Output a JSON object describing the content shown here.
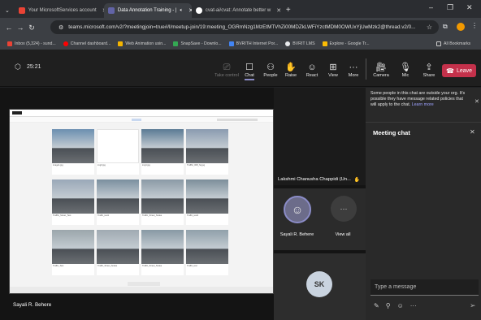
{
  "browser": {
    "tabs": [
      {
        "label": "Your MicrosoftServices account",
        "icon_color": "#ea4335",
        "active": false
      },
      {
        "label": "Data Annotation Training - |",
        "icon_color": "#6264a7",
        "active": true
      },
      {
        "label": "cvat-ai/cvat: Annotate better w",
        "icon_color": "#ffffff",
        "active": false
      }
    ],
    "new_tab": "+",
    "window_controls": [
      "–",
      "❐",
      "✕"
    ],
    "url": "teams.microsoft.com/v2/?meetingjoin=true#/l/meetup-join/19:meeting_OGRmNzg1MzEtMTVhZi00MDZkLWFiYzctMDM0OWUxYjUwMzk2@thread.v2/0..."
  },
  "bookmarks": [
    {
      "label": "Inbox (5,324) - sund...",
      "color": "#ea4335"
    },
    {
      "label": "Channel dashboard...",
      "color": "#ff0000"
    },
    {
      "label": "Web Animation usin...",
      "color": "#f4b400"
    },
    {
      "label": "SnapSave - Downlo...",
      "color": "#34a853"
    },
    {
      "label": "BVRITH Internet Por...",
      "color": "#4285f4"
    },
    {
      "label": "BVRIT LMS",
      "color": "#e8eaed"
    },
    {
      "label": "Explore - Google Tr...",
      "color": "#fbbc04"
    }
  ],
  "all_bookmarks": "All Bookmarks",
  "meeting": {
    "timer": "25:21",
    "toolbar": [
      {
        "label": "Take control",
        "glyph": "⎚",
        "dim": true
      },
      {
        "label": "Chat",
        "glyph": "☐",
        "dim": false
      },
      {
        "label": "People",
        "glyph": "⚇",
        "dim": false
      },
      {
        "label": "Raise",
        "glyph": "✋",
        "dim": false
      },
      {
        "label": "React",
        "glyph": "☺",
        "dim": false
      },
      {
        "label": "View",
        "glyph": "⊞",
        "dim": false
      },
      {
        "label": "More",
        "glyph": "···",
        "dim": false
      }
    ],
    "media": [
      {
        "label": "Camera",
        "glyph": "🎥︎"
      },
      {
        "label": "Mic",
        "glyph": "🎙︎"
      },
      {
        "label": "Share",
        "glyph": "⇪"
      }
    ],
    "leave_label": "Leave",
    "presenter_name": "Sayali R. Behere",
    "participants": [
      {
        "name": "Lakshmi Chanusha Chappidi (Un...",
        "status": "✋"
      },
      {
        "name": "Sayali R. Behere"
      },
      {
        "name": "View all",
        "glyph": "···"
      }
    ],
    "self_initials": "SK"
  },
  "chat": {
    "notice": "Some people in this chat are outside your org. It's possible they have message related policies that will apply to the chat.",
    "learn_more": "Learn more",
    "title": "Meeting chat",
    "placeholder": "Type a message",
    "actions": [
      "✎",
      "⚲",
      "☺",
      "···"
    ],
    "send_glyph": "➢"
  },
  "shared_screen": {
    "items": [
      {
        "name": "image1.jpg",
        "color": "#6b8fb0"
      },
      {
        "name": "img3.jpg",
        "color": "#ffffff"
      },
      {
        "name": "img4.jpg",
        "color": "#5a7a94"
      },
      {
        "name": "Trafffic_008_hq.jpg",
        "color": "#8a9bb0"
      },
      {
        "name": "Trafffic_Street_Test",
        "color": "#9aa8b8"
      },
      {
        "name": "Traffic_test1",
        "color": "#7a8f9f"
      },
      {
        "name": "Traffic_Street_Snake",
        "color": "#8b9aa6"
      },
      {
        "name": "Traffic_test2",
        "color": "#7c8e9a"
      },
      {
        "name": "Traffic_Test",
        "color": "#9ba6ab"
      },
      {
        "name": "Traffic_Street_Snake",
        "color": "#a0aab2"
      },
      {
        "name": "Traffic_Street_Snake",
        "color": "#8899a4"
      },
      {
        "name": "Traffic_test",
        "color": "#90a0aa"
      }
    ]
  }
}
